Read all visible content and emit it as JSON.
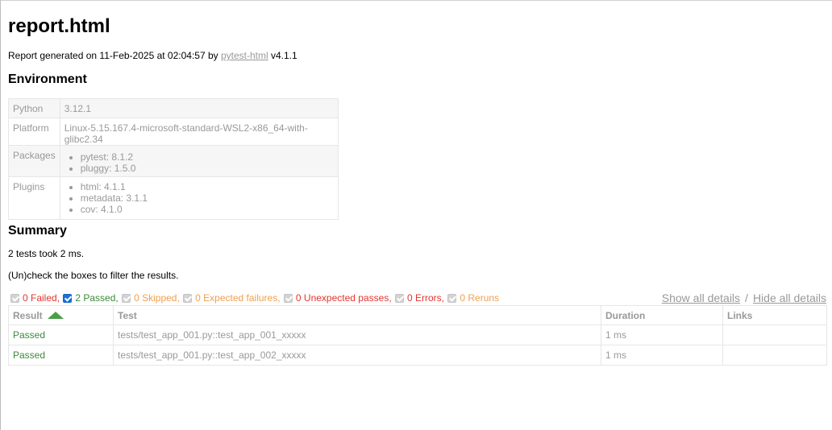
{
  "title": "report.html",
  "generated": {
    "prefix": "Report generated on 11-Feb-2025 at 02:04:57 by ",
    "link": "pytest-html",
    "suffix": " v4.1.1"
  },
  "environment": {
    "heading": "Environment",
    "python": {
      "key": "Python",
      "value": "3.12.1"
    },
    "platform": {
      "key": "Platform",
      "value": "Linux-5.15.167.4-microsoft-standard-WSL2-x86_64-with-glibc2.34"
    },
    "packages": {
      "key": "Packages",
      "items": [
        "pytest: 8.1.2",
        "pluggy: 1.5.0"
      ]
    },
    "plugins": {
      "key": "Plugins",
      "items": [
        "html: 4.1.1",
        "metadata: 3.1.1",
        "cov: 4.1.0"
      ]
    }
  },
  "summary": {
    "heading": "Summary",
    "duration_text": "2 tests took 2 ms.",
    "filter_hint": "(Un)check the boxes to filter the results."
  },
  "filters": {
    "failed": "0 Failed,",
    "passed": "2 Passed,",
    "skipped": "0 Skipped,",
    "xfailed": "0 Expected failures,",
    "xpassed": "0 Unexpected passes,",
    "errors": "0 Errors,",
    "reruns": "0 Reruns"
  },
  "details": {
    "show": "Show all details",
    "separator": "/",
    "hide": "Hide all details"
  },
  "results": {
    "headers": {
      "result": "Result",
      "test": "Test",
      "duration": "Duration",
      "links": "Links"
    },
    "rows": [
      {
        "result": "Passed",
        "test": "tests/test_app_001.py::test_app_001_xxxxx",
        "duration": "1 ms",
        "links": ""
      },
      {
        "result": "Passed",
        "test": "tests/test_app_001.py::test_app_002_xxxxx",
        "duration": "1 ms",
        "links": ""
      }
    ]
  },
  "colors": {
    "failed": "#e3352f",
    "passed": "#3a8a3a",
    "skipped": "#f0a050",
    "muted": "#999999"
  }
}
